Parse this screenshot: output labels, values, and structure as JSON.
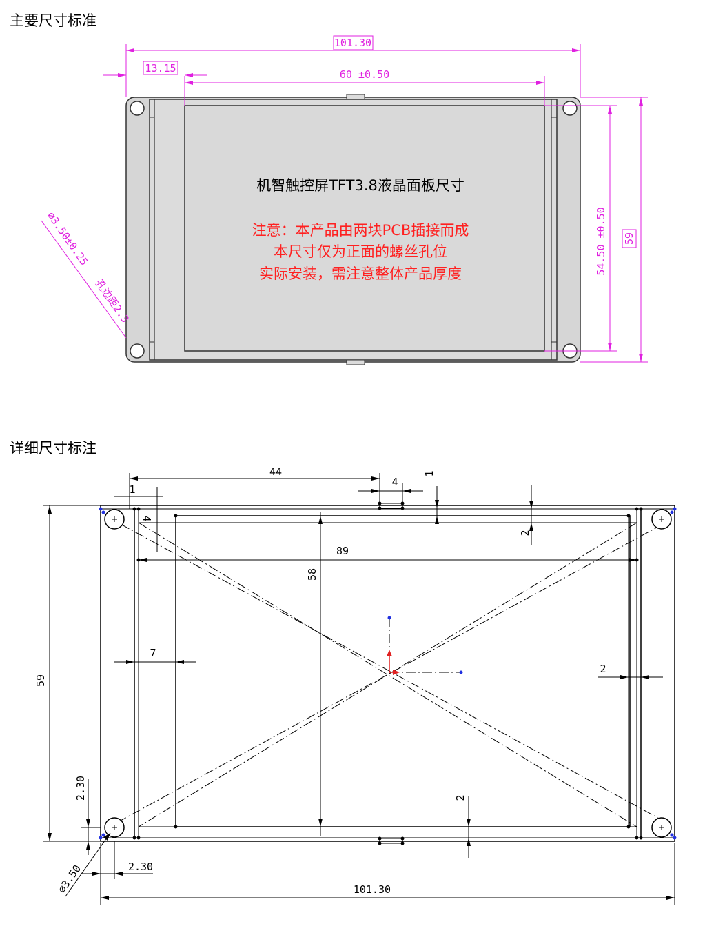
{
  "headings": {
    "main": "主要尺寸标准",
    "detail": "详细尺寸标注"
  },
  "panel": {
    "title": "机智触控屏TFT3.8液晶面板尺寸",
    "notes": [
      "注意：本产品由两块PCB插接而成",
      "本尺寸仅为正面的螺丝孔位",
      "实际安装，需注意整体产品厚度"
    ]
  },
  "top_dims": {
    "overall_width": "101.30",
    "offset": "13.15",
    "screen_width": "60 ±0.50",
    "screen_height": "54.50 ±0.50",
    "overall_height": "59",
    "hole_dia": "∅3.50±0.25",
    "hole_note": "孔边距2.3"
  },
  "detail_dims": {
    "d44": "44",
    "d4a": "4",
    "d1a": "1",
    "d1b": "1",
    "d4b": "4",
    "d2a": "2",
    "d89": "89",
    "d58": "58",
    "d7": "7",
    "d2b": "2",
    "d59": "59",
    "d230a": "2.30",
    "d2c": "2",
    "d350": "∅3.50",
    "d230b": "2.30",
    "d10130": "101.30"
  },
  "colors": {
    "dimension": "#e020e0",
    "note": "#ff2020",
    "panel_fill": "#d6d6d6",
    "screen_fill": "#d9d9d9"
  }
}
